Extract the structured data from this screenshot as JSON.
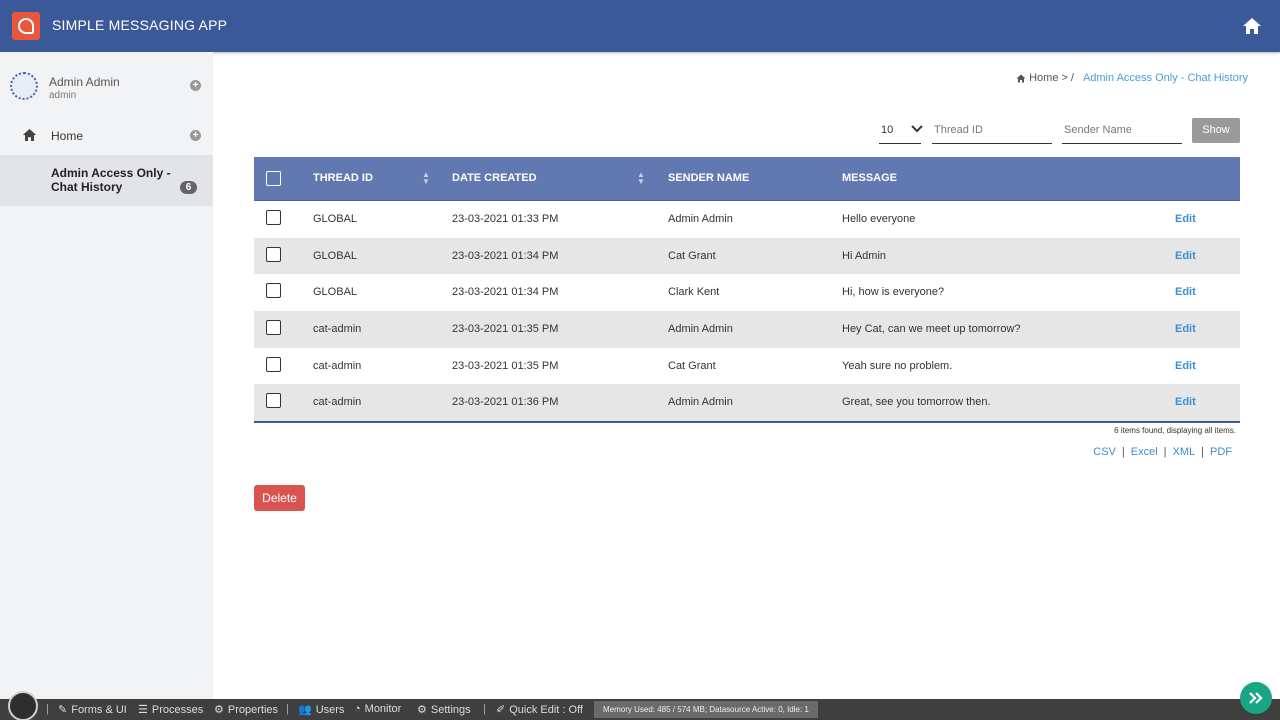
{
  "header": {
    "app_title": "SIMPLE MESSAGING APP",
    "home_icon": "home-icon"
  },
  "sidebar": {
    "user_name": "Admin Admin",
    "user_role": "admin",
    "items": [
      {
        "label": "Home"
      },
      {
        "label": "Admin Access Only - Chat History",
        "badge": "6"
      }
    ]
  },
  "breadcrumb": {
    "home": "Home",
    "separator_1": ">",
    "separator_2": "/",
    "current": "Admin Access Only - Chat History"
  },
  "filters": {
    "page_size": "10",
    "thread_id_placeholder": "Thread ID",
    "sender_name_placeholder": "Sender Name",
    "show_label": "Show"
  },
  "table": {
    "columns": [
      "THREAD ID",
      "DATE CREATED",
      "SENDER NAME",
      "MESSAGE"
    ],
    "edit_label": "Edit",
    "rows": [
      {
        "thread": "GLOBAL",
        "date": "23-03-2021 01:33 PM",
        "sender": "Admin Admin",
        "message": "Hello everyone"
      },
      {
        "thread": "GLOBAL",
        "date": "23-03-2021 01:34 PM",
        "sender": "Cat Grant",
        "message": "Hi Admin"
      },
      {
        "thread": "GLOBAL",
        "date": "23-03-2021 01:34 PM",
        "sender": "Clark Kent",
        "message": "Hi, how is everyone?"
      },
      {
        "thread": "cat-admin",
        "date": "23-03-2021 01:35 PM",
        "sender": "Admin Admin",
        "message": "Hey Cat, can we meet up tomorrow?"
      },
      {
        "thread": "cat-admin",
        "date": "23-03-2021 01:35 PM",
        "sender": "Cat Grant",
        "message": "Yeah sure no problem."
      },
      {
        "thread": "cat-admin",
        "date": "23-03-2021 01:36 PM",
        "sender": "Admin Admin",
        "message": "Great, see you tomorrow then."
      }
    ],
    "summary": "6 items found, displaying all items."
  },
  "exports": {
    "csv": "CSV",
    "excel": "Excel",
    "xml": "XML",
    "pdf": "PDF",
    "separator": "|"
  },
  "actions": {
    "delete_label": "Delete"
  },
  "bottombar": {
    "forms_ui": "Forms & UI",
    "processes": "Processes",
    "properties": "Properties",
    "users": "Users",
    "monitor": "Monitor",
    "settings": "Settings",
    "quick_edit": "Quick Edit : Off",
    "memory": "Memory Used: 485 / 574 MB; Datasource Active: 0, Idle: 1",
    "separator": "|"
  },
  "colors": {
    "header": "#3b5998",
    "table_head": "#6278b0",
    "link": "#3a8fd5",
    "danger": "#d9534f",
    "fab": "#1aa584"
  }
}
